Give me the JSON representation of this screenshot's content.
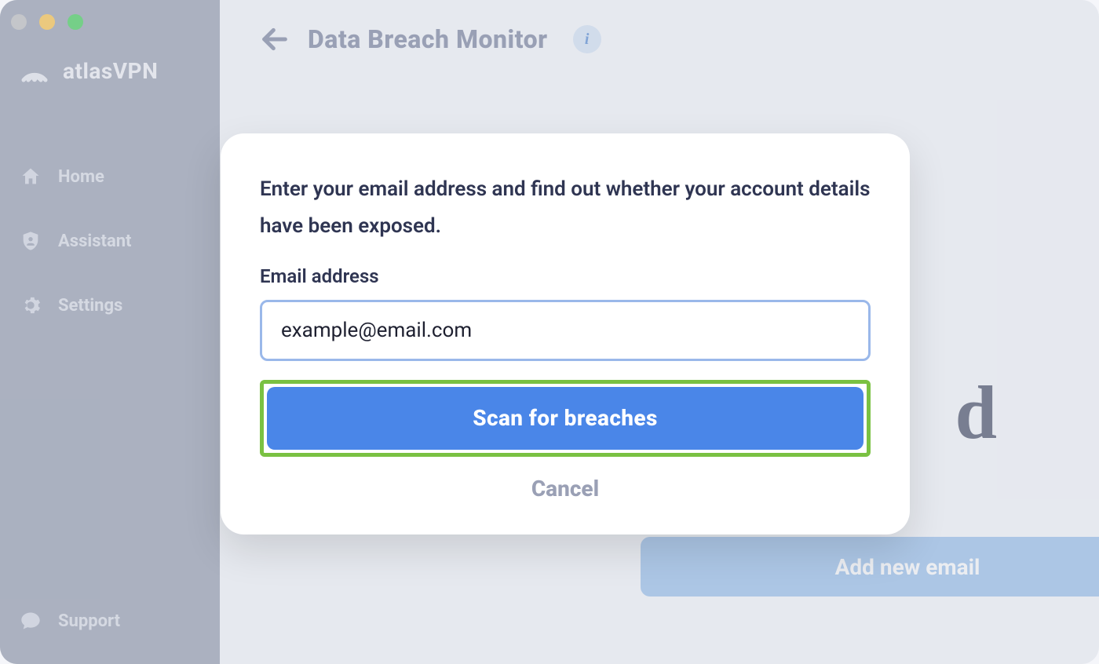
{
  "brand": {
    "name": "atlasVPN"
  },
  "sidebar": {
    "items": [
      {
        "label": "Home",
        "icon": "home-icon"
      },
      {
        "label": "Assistant",
        "icon": "shield-person-icon"
      },
      {
        "label": "Settings",
        "icon": "gear-icon"
      }
    ],
    "support_label": "Support"
  },
  "page": {
    "title": "Data Breach Monitor",
    "info_badge": "i",
    "add_email_label": "Add new email",
    "bg_letter": "d"
  },
  "modal": {
    "description": "Enter your email address and find out whether your account details have been exposed.",
    "email_label": "Email address",
    "email_value": "example@email.com",
    "scan_label": "Scan for breaches",
    "cancel_label": "Cancel"
  },
  "colors": {
    "primary": "#4a86e8",
    "highlight_border": "#7ac142",
    "sidebar_bg": "#8a92a6"
  }
}
